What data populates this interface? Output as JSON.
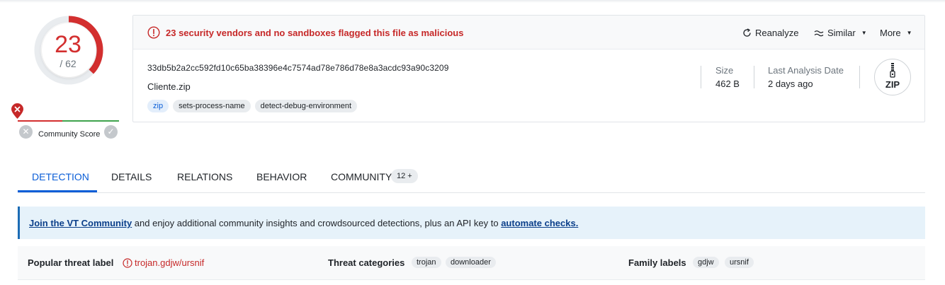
{
  "score": {
    "detections": "23",
    "total": "/ 62",
    "colors": {
      "accent": "#d32f2f",
      "ring": "#e9ecef"
    },
    "detection_ratio": 0.371
  },
  "community": {
    "label": "Community Score",
    "icons": [
      "x-pin-icon",
      "x-circle-icon",
      "check-circle-icon"
    ]
  },
  "alert": {
    "text": "23 security vendors and no sandboxes flagged this file as malicious",
    "icon": "alert-circle-icon",
    "color": "#c62828"
  },
  "actions": {
    "reanalyze": "Reanalyze",
    "similar": "Similar",
    "more": "More"
  },
  "file": {
    "hash": "33db5b2a2cc592fd10c65ba38396e4c7574ad78e786d78e8a3acdc93a90c3209",
    "name": "Cliente.zip",
    "tags": [
      "zip",
      "sets-process-name",
      "detect-debug-environment"
    ]
  },
  "meta": {
    "size_label": "Size",
    "size_value": "462 B",
    "date_label": "Last Analysis Date",
    "date_value": "2 days ago",
    "type_badge": "ZIP"
  },
  "tabs": {
    "items": [
      "DETECTION",
      "DETAILS",
      "RELATIONS",
      "BEHAVIOR",
      "COMMUNITY"
    ],
    "active": "DETECTION",
    "community_badge": "12 +"
  },
  "banner": {
    "link1": "Join the VT Community",
    "middle": " and enjoy additional community insights and crowdsourced detections, plus an API key to ",
    "link2": "automate checks."
  },
  "threat": {
    "popular_label": "Popular threat label",
    "popular_value": "trojan.gdjw/ursnif",
    "categories_label": "Threat categories",
    "categories": [
      "trojan",
      "downloader"
    ],
    "family_label": "Family labels",
    "families": [
      "gdjw",
      "ursnif"
    ]
  }
}
